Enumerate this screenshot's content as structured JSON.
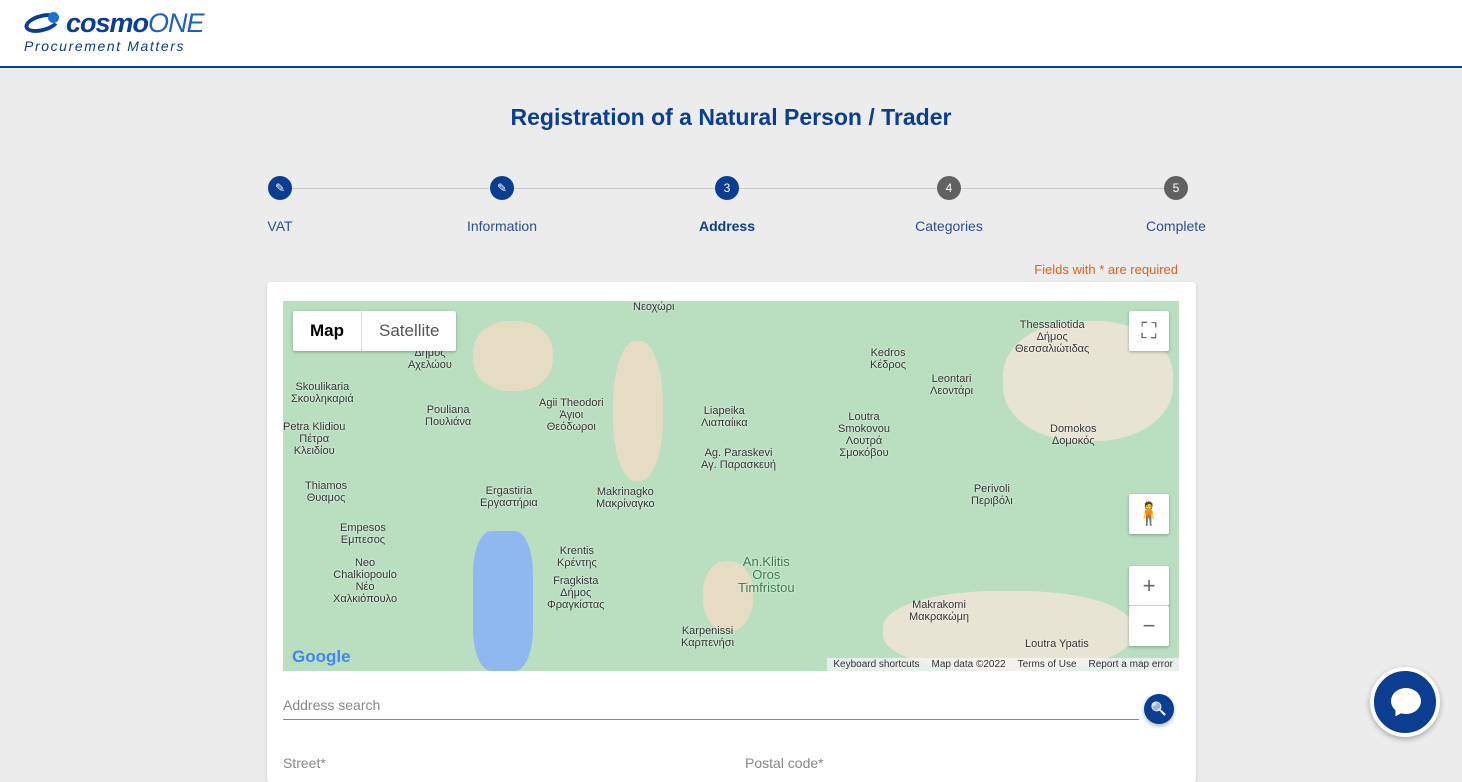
{
  "header": {
    "brand_bold": "cosmo",
    "brand_light": "ONE",
    "tagline": "Procurement Matters"
  },
  "page_title": "Registration of a Natural Person / Trader",
  "steps": [
    {
      "label": "VAT",
      "marker": "✎",
      "state": "done"
    },
    {
      "label": "Information",
      "marker": "✎",
      "state": "done"
    },
    {
      "label": "Address",
      "marker": "3",
      "state": "active"
    },
    {
      "label": "Categories",
      "marker": "4",
      "state": "pending"
    },
    {
      "label": "Complete",
      "marker": "5",
      "state": "pending"
    }
  ],
  "required_note": "Fields with * are required",
  "map": {
    "type_map": "Map",
    "type_satellite": "Satellite",
    "fullscreen_icon": "⛶",
    "pegman_icon": "🧍",
    "zoom_in": "+",
    "zoom_out": "−",
    "google": "Google",
    "attribution": {
      "shortcuts": "Keyboard shortcuts",
      "data": "Map data ©2022",
      "terms": "Terms of Use",
      "report": "Report a map error"
    },
    "places": [
      "Νεοχώρι",
      "Δήμος\nΑχελώου",
      "Skoulikaria\nΣκουληκαριά",
      "Pouliana\nΠουλιάνα",
      "Agii Theodori\nΆγιοι\nΘεόδωροι",
      "Liapeika\nΛιαπαίικα",
      "Kedros\nΚέδρος",
      "Thessaliotida\nΔήμος\nΘεσσαλιώτιδας",
      "Leontari\nΛεοντάρι",
      "Loutra\nSmokovou\nΛουτρά\nΣμοκόβου",
      "Domokos\nΔομοκός",
      "Petra Klidiou\nΠέτρα\nΚλειδίου",
      "Ag. Paraskevi\nΑγ. Παρασκευή",
      "Thiamos\nΘυαμος",
      "Ergastiria\nΕργαστήρια",
      "Makrinagko\nΜακρίναγκο",
      "Perivoli\nΠεριβόλι",
      "Empesos\nΕμπεσος",
      "Krentis\nΚρέντης",
      "An.Klitis\nOros\nTimfristou",
      "Neo\nChalkiopoulo\nΝέο\nΧαλκιόπουλο",
      "Fragkista\nΔήμος\nΦραγκίστας",
      "Makrakomi\nΜακρακώμη",
      "Karpenissi\nΚαρπενήσι",
      "Loutra Ypatis"
    ]
  },
  "address_search_placeholder": "Address search",
  "search_icon": "🔍",
  "fields": {
    "street": "Street*",
    "postal": "Postal code*"
  }
}
